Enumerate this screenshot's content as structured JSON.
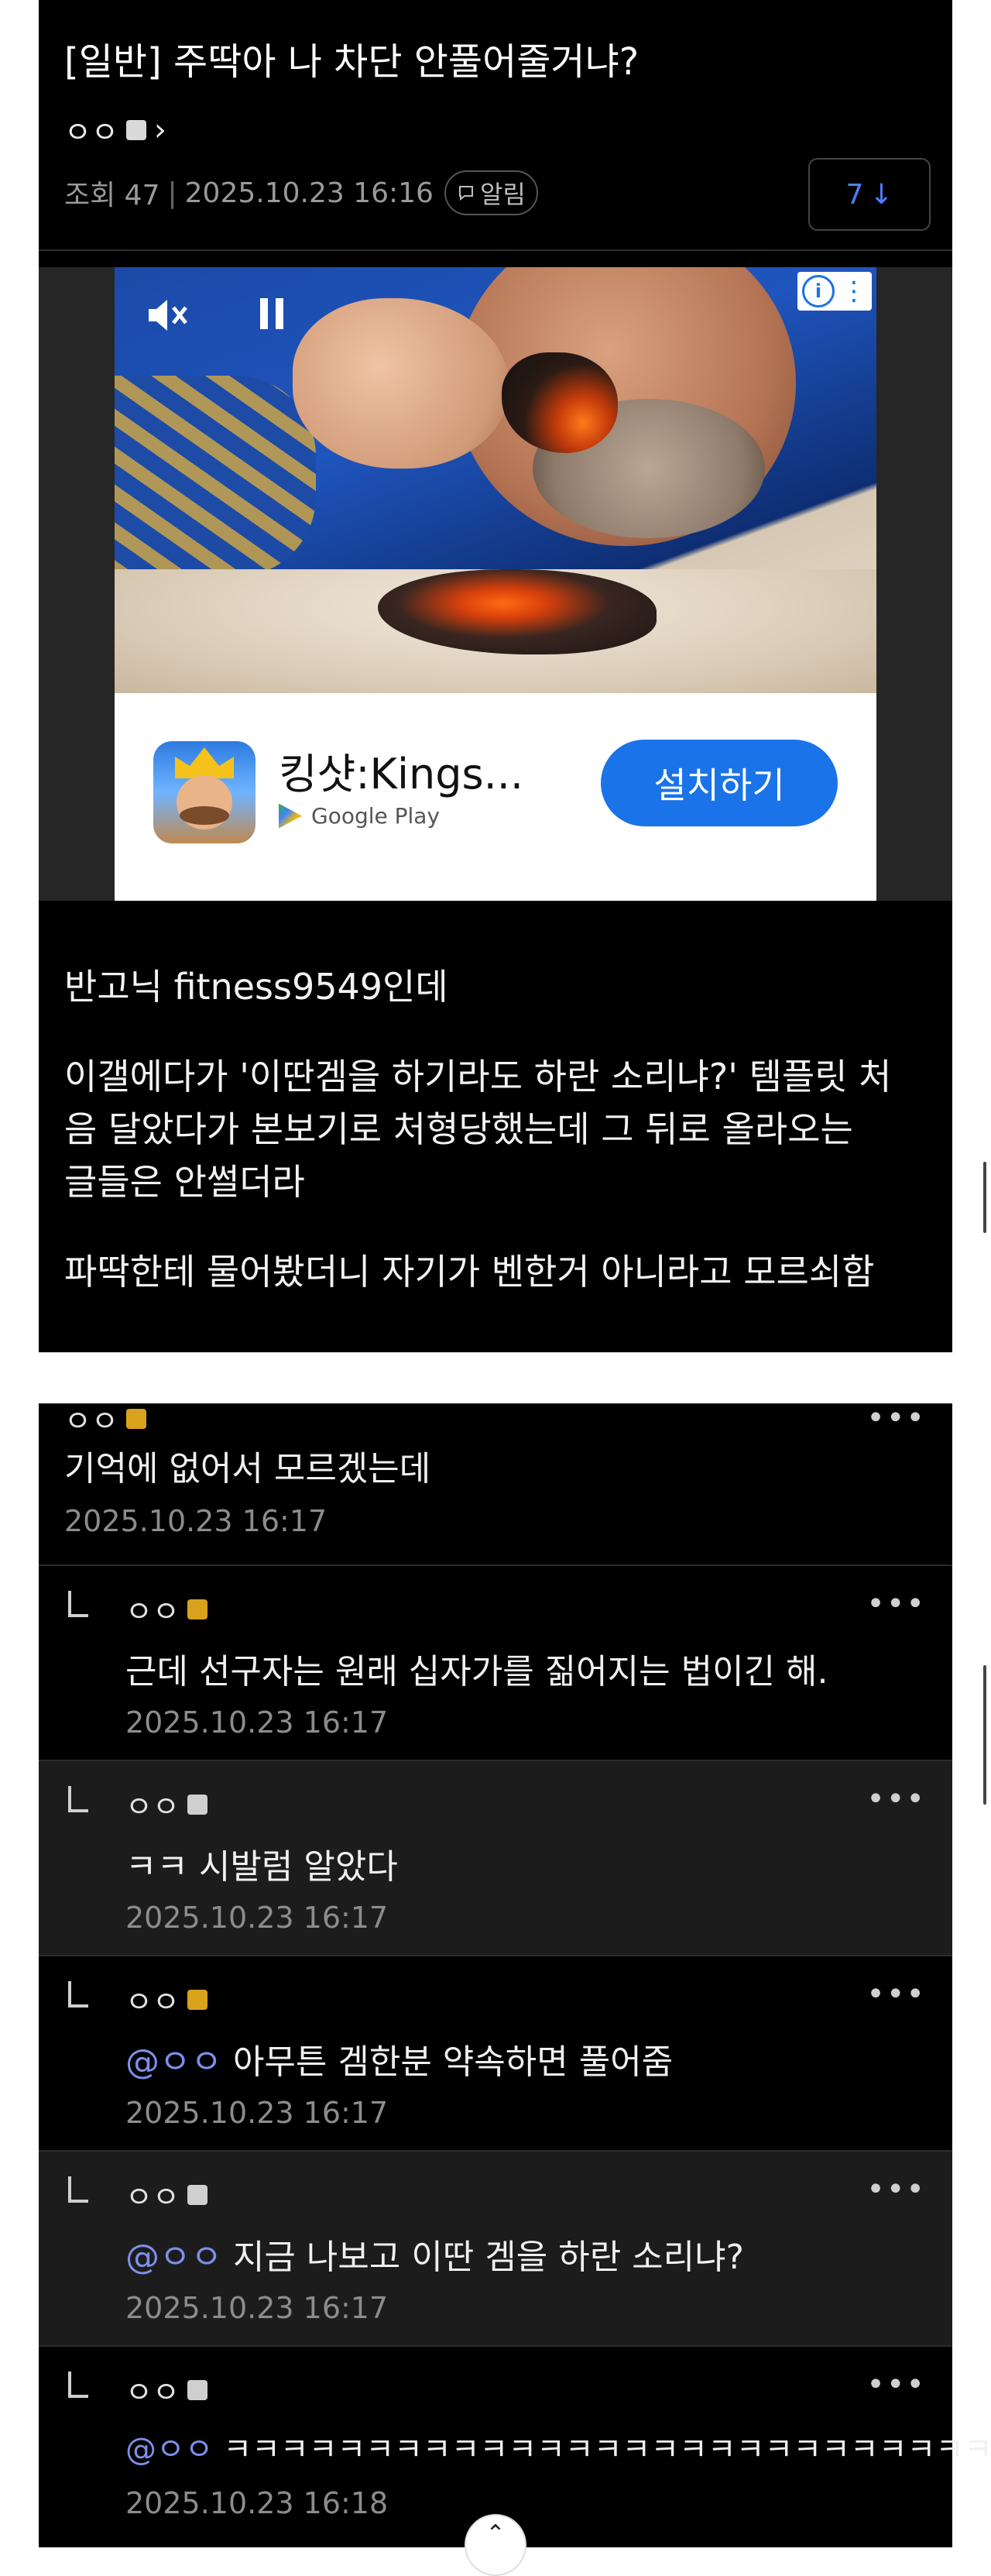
{
  "post": {
    "title": "[일반] 주딱아 나 차단 안풀어줄거냐?",
    "author": "ㅇㅇ",
    "views": "조회 47",
    "datetime": "2025.10.23 16:16",
    "alarm_label": "알림",
    "reply_count": "7",
    "reply_arrow": "↓",
    "body": [
      "반고닉 fitness9549인데",
      "이갤에다가 '이딴겜을 하기라도 하란 소리냐?' 템플릿 처",
      "음 달았다가 본보기로 처형당했는데 그 뒤로 올라오는",
      "글들은 안썰더라",
      "파딱한테 물어봤더니 자기가 벤한거 아니라고 모르쇠함"
    ]
  },
  "ad": {
    "app_name": "킹샷:Kings...",
    "store": "Google Play",
    "install_label": "설치하기",
    "icon": "ad-info-icon"
  },
  "comments": [
    {
      "author": "ㅇㅇ",
      "text": "기억에 없어서 모르겠는데",
      "date": "2025.10.23 16:17",
      "reply": false,
      "badge": "yellow"
    },
    {
      "author": "ㅇㅇ",
      "text": "근데 선구자는 원래 십자가를 짊어지는 법이긴 해.",
      "date": "2025.10.23 16:17",
      "reply": true,
      "badge": "yellow"
    },
    {
      "author": "ㅇㅇ",
      "text": "ㅋㅋ 시발럼 알았다",
      "date": "2025.10.23 16:17",
      "reply": true,
      "badge": "gray"
    },
    {
      "author": "ㅇㅇ",
      "mention": "@ㅇㅇ",
      "text": " 아무튼 겜한분 약속하면 풀어줌",
      "date": "2025.10.23 16:17",
      "reply": true,
      "badge": "yellow"
    },
    {
      "author": "ㅇㅇ",
      "mention": "@ㅇㅇ",
      "text": " 지금 나보고 이딴 겜을 하란 소리냐?",
      "date": "2025.10.23 16:17",
      "reply": true,
      "badge": "gray"
    },
    {
      "author": "ㅇㅇ",
      "mention": "@ㅇㅇ",
      "text": " ㅋㅋㅋㅋㅋㅋㅋㅋㅋㅋㅋㅋㅋㅋㅋㅋㅋㅋㅋㅋㅋㅋㅋㅋㅋㅋㅋ",
      "date": "2025.10.23 16:18",
      "reply": true,
      "badge": "gray"
    }
  ],
  "ui": {
    "more_label": "•••",
    "chevron": "›",
    "scroll_top_glyph": "⌃"
  }
}
